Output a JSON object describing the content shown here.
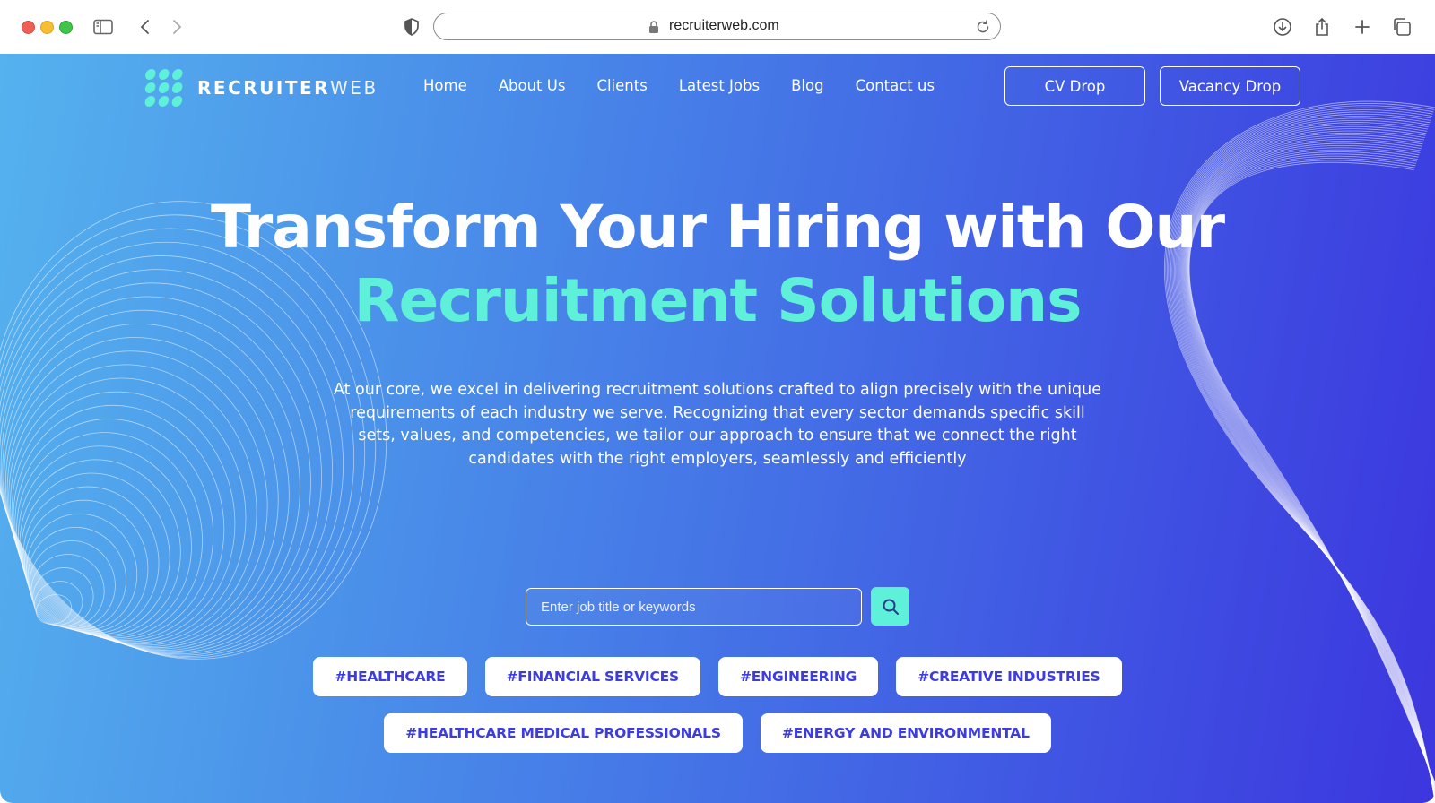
{
  "browser": {
    "url": "recruiterweb.com",
    "icons": [
      "sidebar-icon",
      "back-icon",
      "forward-icon",
      "shield-icon",
      "lock-icon",
      "reload-icon",
      "download-icon",
      "share-icon",
      "new-tab-icon",
      "tabs-icon"
    ]
  },
  "site": {
    "logo": {
      "bold": "RECRUITER",
      "light": "WEB"
    },
    "nav": [
      "Home",
      "About Us",
      "Clients",
      "Latest Jobs",
      "Blog",
      "Contact us"
    ],
    "cta": {
      "cv_drop": "CV Drop",
      "vacancy_drop": "Vacancy Drop"
    }
  },
  "hero": {
    "headline_line1": "Transform Your Hiring with Our",
    "headline_line2": "Recruitment Solutions",
    "description": "At our core, we excel in delivering recruitment solutions crafted to align precisely with the unique requirements of each industry we serve. Recognizing that every sector demands specific skill sets, values, and competencies, we tailor our approach to ensure that we connect the right candidates with the right employers, seamlessly and efficiently",
    "search": {
      "placeholder": "Enter job title or keywords",
      "value": ""
    },
    "tags_row1": [
      "#HEALTHCARE",
      "#FINANCIAL SERVICES",
      "#ENGINEERING",
      "#CREATIVE INDUSTRIES"
    ],
    "tags_row2": [
      "#HEALTHCARE MEDICAL PROFESSIONALS",
      "#ENERGY AND ENVIRONMENTAL"
    ]
  },
  "colors": {
    "accent": "#5ff0d9",
    "tag_text": "#3d3ce0",
    "gradient_start": "#55b2ee",
    "gradient_end": "#3c36de"
  }
}
